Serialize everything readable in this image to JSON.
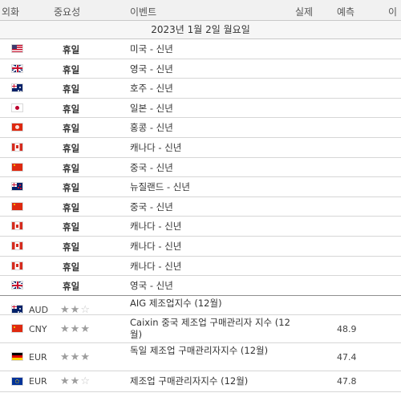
{
  "header": {
    "currency": "외화",
    "importance": "중요성",
    "event": "이벤트",
    "actual": "실제",
    "forecast": "예측",
    "previous": "이"
  },
  "date_label": "2023년 1월 2일 월요일",
  "rows": [
    {
      "flag": "us",
      "currency": "",
      "importance": "휴일",
      "event": "미국 - 신년",
      "forecast": ""
    },
    {
      "flag": "gb",
      "currency": "",
      "importance": "휴일",
      "event": "영국 - 신년",
      "forecast": ""
    },
    {
      "flag": "au",
      "currency": "",
      "importance": "휴일",
      "event": "호주 - 신년",
      "forecast": ""
    },
    {
      "flag": "jp",
      "currency": "",
      "importance": "휴일",
      "event": "일본 - 신년",
      "forecast": ""
    },
    {
      "flag": "hk",
      "currency": "",
      "importance": "휴일",
      "event": "홍콩 - 신년",
      "forecast": ""
    },
    {
      "flag": "ca",
      "currency": "",
      "importance": "휴일",
      "event": "캐나다 - 신년",
      "forecast": ""
    },
    {
      "flag": "cn",
      "currency": "",
      "importance": "휴일",
      "event": "중국 - 신년",
      "forecast": ""
    },
    {
      "flag": "nz",
      "currency": "",
      "importance": "휴일",
      "event": "뉴질랜드 - 신년",
      "forecast": ""
    },
    {
      "flag": "cn",
      "currency": "",
      "importance": "휴일",
      "event": "중국 - 신년",
      "forecast": ""
    },
    {
      "flag": "ca",
      "currency": "",
      "importance": "휴일",
      "event": "캐나다 - 신년",
      "forecast": ""
    },
    {
      "flag": "ca",
      "currency": "",
      "importance": "휴일",
      "event": "캐나다 - 신년",
      "forecast": ""
    },
    {
      "flag": "ca",
      "currency": "",
      "importance": "휴일",
      "event": "캐나다 - 신년",
      "forecast": ""
    },
    {
      "flag": "gb",
      "currency": "",
      "importance": "휴일",
      "event": "영국 - 신년",
      "forecast": ""
    },
    {
      "flag": "au",
      "currency": "AUD",
      "stars": 2,
      "event": "AIG 제조업지수 (12월)",
      "forecast": ""
    },
    {
      "flag": "cn",
      "currency": "CNY",
      "stars": 3,
      "event": "Caixin 중국 제조업 구매관리자 지수 (12월)",
      "forecast": "48.9"
    },
    {
      "flag": "de",
      "currency": "EUR",
      "stars": 3,
      "event": "독일 제조업 구매관리자지수 (12월)",
      "forecast": "47.4"
    },
    {
      "flag": "eu",
      "currency": "EUR",
      "stars": 2,
      "event": "제조업 구매관리자지수 (12월)",
      "forecast": "47.8"
    }
  ]
}
